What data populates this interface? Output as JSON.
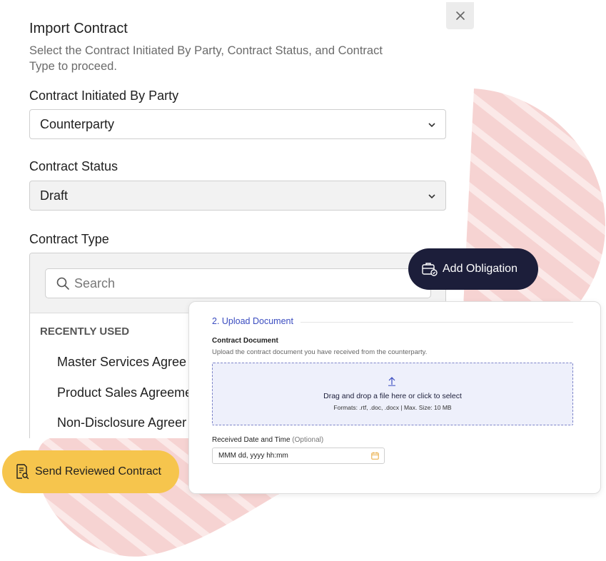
{
  "modal": {
    "title": "Import Contract",
    "subtitle": "Select the Contract Initiated By Party, Contract Status, and Contract Type to proceed.",
    "close_icon": "close-icon"
  },
  "initiated_by": {
    "label": "Contract Initiated By Party",
    "value": "Counterparty"
  },
  "status": {
    "label": "Contract Status",
    "value": "Draft"
  },
  "contract_type": {
    "label": "Contract Type",
    "search_placeholder": "Search",
    "section_label": "RECENTLY USED",
    "items": [
      "Master Services Agree",
      "Product Sales Agreeme",
      "Non-Disclosure Agreer"
    ]
  },
  "add_obligation": {
    "label": "Add Obligation",
    "icon": "obligation-icon"
  },
  "send_reviewed": {
    "label": "Send Reviewed Contract",
    "icon": "document-search-icon"
  },
  "upload": {
    "step_title": "2. Upload Document",
    "field_label": "Contract Document",
    "field_desc": "Upload the contract document you have received from the counterparty.",
    "drop_text": "Drag and drop a file here or click to select",
    "formats_text": "Formats: .rtf, .doc, .docx | Max. Size: 10 MB",
    "date_label": "Received Date and Time",
    "date_optional": "(Optional)",
    "date_placeholder": "MMM dd, yyyy hh:mm"
  },
  "colors": {
    "accent_dark": "#1c1e3a",
    "accent_yellow": "#f6c54d",
    "link_blue": "#3a4cc0",
    "blob_pink": "#f6d3d2"
  }
}
